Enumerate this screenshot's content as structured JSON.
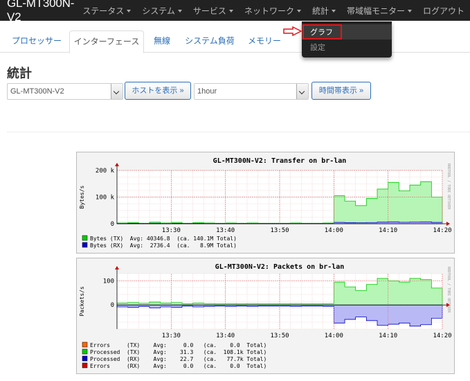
{
  "nav": {
    "brand": "GL-MT300N-V2",
    "items": [
      {
        "label": "ステータス",
        "caret": true
      },
      {
        "label": "システム",
        "caret": true
      },
      {
        "label": "サービス",
        "caret": true
      },
      {
        "label": "ネットワーク",
        "caret": true
      },
      {
        "label": "統計",
        "caret": true
      },
      {
        "label": "帯域幅モニター",
        "caret": true
      },
      {
        "label": "ログアウト",
        "caret": false
      }
    ],
    "dropdown": [
      "グラフ",
      "設定"
    ]
  },
  "tabs": [
    "プロセッサー",
    "インターフェース",
    "無線",
    "システム負荷",
    "メモリー"
  ],
  "page": {
    "title": "統計",
    "host_select": "GL-MT300N-V2",
    "host_button": "ホストを表示 »",
    "time_select": "1hour",
    "time_button": "時間帯表示 »"
  },
  "graphs": [
    {
      "title": "GL-MT300N-V2: Transfer on br-lan",
      "ylabel": "Bytes/s",
      "side": "RRDTOOL / TOBI OETIKER",
      "yticks": [
        "200 k",
        "100 k",
        "0"
      ],
      "xticks": [
        "13:30",
        "13:40",
        "13:50",
        "14:00",
        "14:10",
        "14:20"
      ],
      "legend": [
        {
          "color": "#00cc00",
          "text": "Bytes (TX)  Avg: 40346.8  (ca. 140.1M Total)"
        },
        {
          "color": "#0000cc",
          "text": "Bytes (RX)  Avg:  2736.4  (ca.   8.9M Total)"
        }
      ]
    },
    {
      "title": "GL-MT300N-V2: Packets on br-lan",
      "ylabel": "Packets/s",
      "side": "RRDTOOL / TOBI OETIKER",
      "yticks": [
        "100",
        "0"
      ],
      "xticks": [
        "13:30",
        "13:40",
        "13:50",
        "14:00",
        "14:10",
        "14:20"
      ],
      "legend": [
        {
          "color": "#ff6600",
          "text": "Errors     (TX)    Avg:     0.0   (ca.    0.0  Total)"
        },
        {
          "color": "#00cc00",
          "text": "Processed  (TX)    Avg:    31.3   (ca.  108.1k Total)"
        },
        {
          "color": "#0000cc",
          "text": "Processed  (RX)    Avg:    22.7   (ca.   77.7k Total)"
        },
        {
          "color": "#cc0000",
          "text": "Errors     (RX)    Avg:     0.0   (ca.    0.0  Total)"
        }
      ]
    }
  ],
  "chart_data": [
    {
      "type": "area",
      "title": "GL-MT300N-V2: Transfer on br-lan",
      "ylabel": "Bytes/s",
      "x": [
        "13:20",
        "13:22",
        "13:24",
        "13:26",
        "13:28",
        "13:30",
        "13:32",
        "13:34",
        "13:36",
        "13:38",
        "13:40",
        "13:42",
        "13:44",
        "13:46",
        "13:48",
        "13:50",
        "13:52",
        "13:54",
        "13:56",
        "13:58",
        "14:00",
        "14:02",
        "14:04",
        "14:06",
        "14:08",
        "14:10",
        "14:12",
        "14:14",
        "14:16",
        "14:18",
        "14:20"
      ],
      "series": [
        {
          "name": "Bytes (TX)",
          "values": [
            3000,
            4000,
            2000,
            6000,
            3000,
            5000,
            2000,
            4000,
            3000,
            2000,
            3000,
            2000,
            3000,
            2000,
            2000,
            2000,
            3000,
            2000,
            2000,
            3000,
            105000,
            85000,
            68000,
            95000,
            130000,
            155000,
            123000,
            145000,
            158000,
            100000,
            25000
          ]
        },
        {
          "name": "Bytes (RX)",
          "values": [
            1000,
            1500,
            1000,
            2000,
            1000,
            1500,
            1000,
            1200,
            1000,
            800,
            1000,
            900,
            1000,
            800,
            800,
            900,
            1000,
            800,
            900,
            1000,
            5000,
            4000,
            3500,
            4500,
            6000,
            7000,
            5500,
            6500,
            7000,
            5000,
            1500
          ]
        }
      ],
      "ylim": [
        0,
        200000
      ]
    },
    {
      "type": "area",
      "title": "GL-MT300N-V2: Packets on br-lan",
      "ylabel": "Packets/s",
      "x": [
        "13:20",
        "13:22",
        "13:24",
        "13:26",
        "13:28",
        "13:30",
        "13:32",
        "13:34",
        "13:36",
        "13:38",
        "13:40",
        "13:42",
        "13:44",
        "13:46",
        "13:48",
        "13:50",
        "13:52",
        "13:54",
        "13:56",
        "13:58",
        "14:00",
        "14:02",
        "14:04",
        "14:06",
        "14:08",
        "14:10",
        "14:12",
        "14:14",
        "14:16",
        "14:18",
        "14:20"
      ],
      "series": [
        {
          "name": "Processed (TX)",
          "values": [
            8,
            10,
            7,
            12,
            8,
            10,
            5,
            8,
            6,
            5,
            6,
            5,
            6,
            5,
            5,
            5,
            6,
            5,
            5,
            6,
            95,
            75,
            60,
            85,
            110,
            100,
            95,
            110,
            105,
            70,
            20
          ]
        },
        {
          "name": "Processed (RX)",
          "values": [
            -8,
            -10,
            -7,
            -12,
            -8,
            -10,
            -5,
            -8,
            -6,
            -5,
            -6,
            -5,
            -6,
            -5,
            -5,
            -5,
            -6,
            -5,
            -5,
            -6,
            -75,
            -60,
            -50,
            -65,
            -85,
            -80,
            -75,
            -88,
            -82,
            -55,
            -18
          ]
        }
      ],
      "ylim": [
        -100,
        130
      ]
    }
  ]
}
